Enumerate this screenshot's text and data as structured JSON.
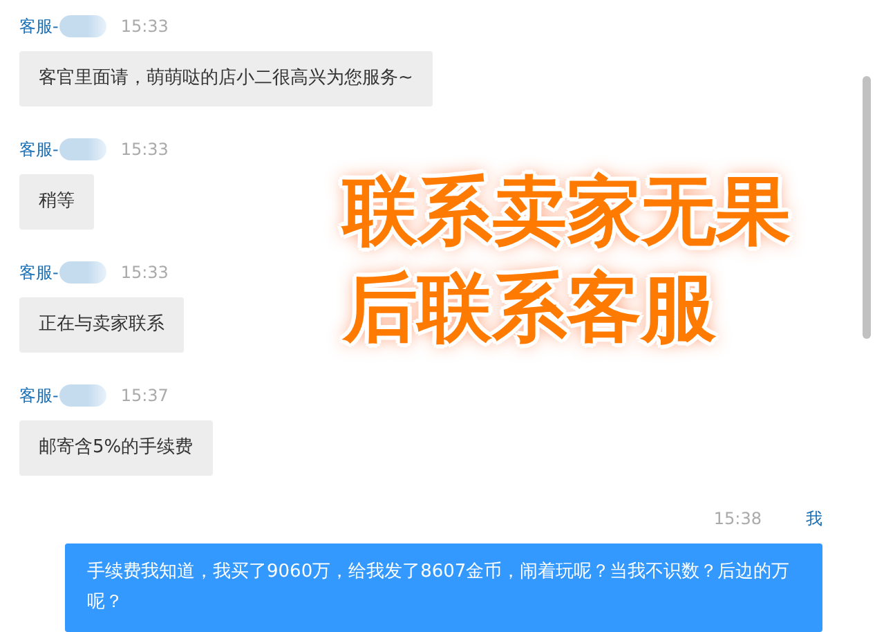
{
  "messages": [
    {
      "kind": "received",
      "sender": "客服-",
      "sender_redacted": true,
      "time": "15:33",
      "text": "客官里面请，萌萌哒的店小二很高兴为您服务~"
    },
    {
      "kind": "received",
      "sender": "客服-",
      "sender_redacted": true,
      "time": "15:33",
      "text": "稍等"
    },
    {
      "kind": "received",
      "sender": "客服-",
      "sender_redacted": true,
      "time": "15:33",
      "text": "正在与卖家联系"
    },
    {
      "kind": "received",
      "sender": "客服-",
      "sender_redacted": true,
      "time": "15:37",
      "text": "邮寄含5%的手续费"
    },
    {
      "kind": "sent",
      "sender": "我",
      "time": "15:38",
      "text": "手续费我知道，我买了9060万，给我发了8607金币，闹着玩呢？当我不识数？后边的万呢？"
    }
  ],
  "annotation": {
    "lines": [
      "联系卖家无果",
      "后联系客服"
    ]
  }
}
